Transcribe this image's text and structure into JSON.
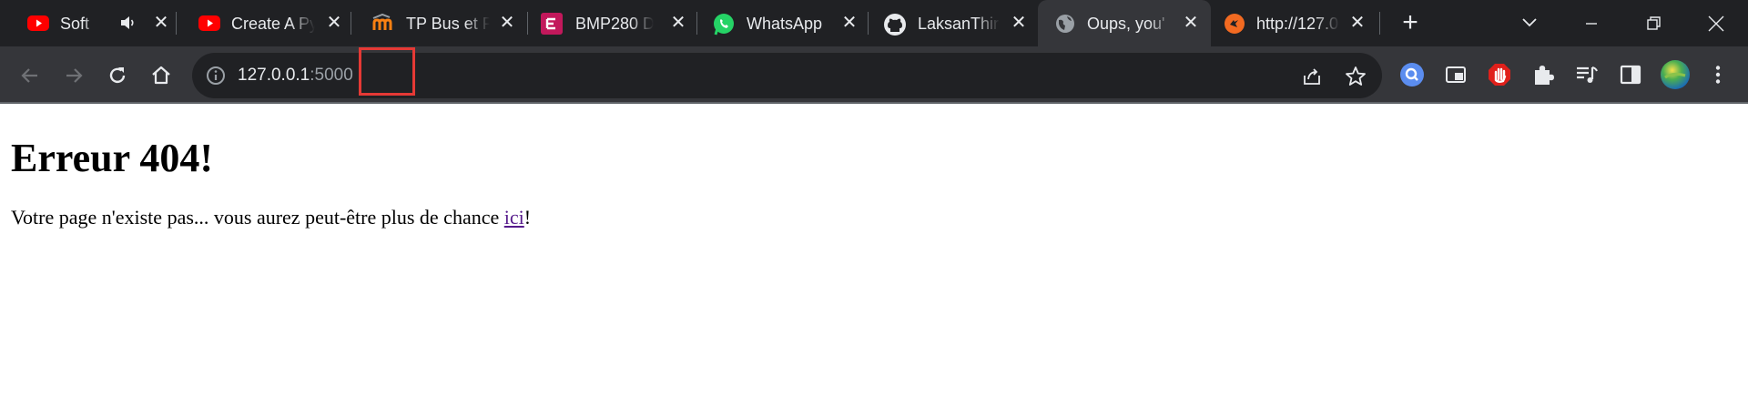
{
  "tabs": [
    {
      "title": "Soft Fe",
      "favicon": "youtube-icon",
      "audio": true,
      "active": false
    },
    {
      "title": "Create A Py",
      "favicon": "youtube-icon",
      "active": false
    },
    {
      "title": "TP Bus et P",
      "favicon": "moodle-icon",
      "active": false
    },
    {
      "title": "BMP280 D",
      "favicon": "elektor-icon",
      "active": false
    },
    {
      "title": "WhatsApp",
      "favicon": "whatsapp-icon",
      "active": false
    },
    {
      "title": "LaksanThir",
      "favicon": "github-icon",
      "active": false
    },
    {
      "title": "Oups, you'",
      "favicon": "globe-icon",
      "active": true
    },
    {
      "title": "http://127.0",
      "favicon": "flask-icon",
      "active": false
    }
  ],
  "omnibox": {
    "host": "127.0.0.1",
    "port": ":5000"
  },
  "page": {
    "heading": "Erreur 404!",
    "text_before": "Votre page n'existe pas... vous aurez peut-être plus de chance ",
    "link": "ici",
    "text_after": "!"
  },
  "colors": {
    "tabstrip_bg": "#202124",
    "toolbar_bg": "#35363a",
    "omnibox_bg": "#202124",
    "highlight_box": "#e53935",
    "visited_link": "#551a8b"
  }
}
